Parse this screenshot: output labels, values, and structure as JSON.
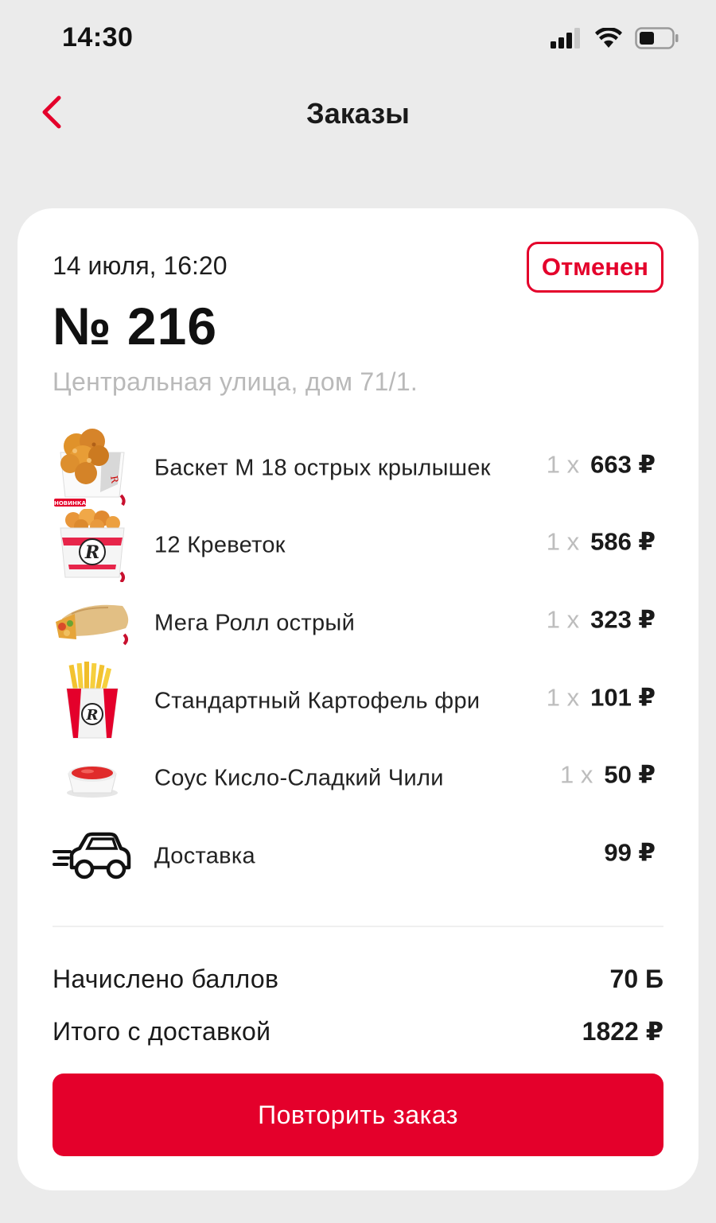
{
  "status_bar": {
    "time": "14:30",
    "icons": [
      "cellular-signal-icon",
      "wifi-icon",
      "battery-icon"
    ]
  },
  "header": {
    "title": "Заказы",
    "back_icon": "chevron-left-icon"
  },
  "order": {
    "date": "14 июля, 16:20",
    "number": "№ 216",
    "status": "Отменен",
    "address": "Центральная улица, дом 71/1."
  },
  "items": [
    {
      "name": "Баскет М 18 острых крылышек",
      "qty": "1 x",
      "price": "663 ₽",
      "icon": "chicken-basket-image",
      "badge": "НОВИНКА"
    },
    {
      "name": "12 Креветок",
      "qty": "1 x",
      "price": "586 ₽",
      "icon": "shrimp-bucket-image"
    },
    {
      "name": "Мега Ролл острый",
      "qty": "1 x",
      "price": "323 ₽",
      "icon": "wrap-roll-image"
    },
    {
      "name": "Стандартный Картофель фри",
      "qty": "1 x",
      "price": "101 ₽",
      "icon": "fries-image"
    },
    {
      "name": "Соус Кисло-Сладкий Чили",
      "qty": "1 x",
      "price": "50 ₽",
      "icon": "sauce-cup-image"
    },
    {
      "name": "Доставка",
      "qty": "",
      "price": "99 ₽",
      "icon": "delivery-car-icon"
    }
  ],
  "summary": {
    "points_label": "Начислено баллов",
    "points_value": "70 Б",
    "total_label": "Итого с доставкой",
    "total_value": "1822 ₽"
  },
  "actions": {
    "repeat_label": "Повторить заказ"
  },
  "colors": {
    "accent": "#e4002b",
    "background": "#ebebeb",
    "card": "#ffffff",
    "muted": "#b9b9b9"
  }
}
